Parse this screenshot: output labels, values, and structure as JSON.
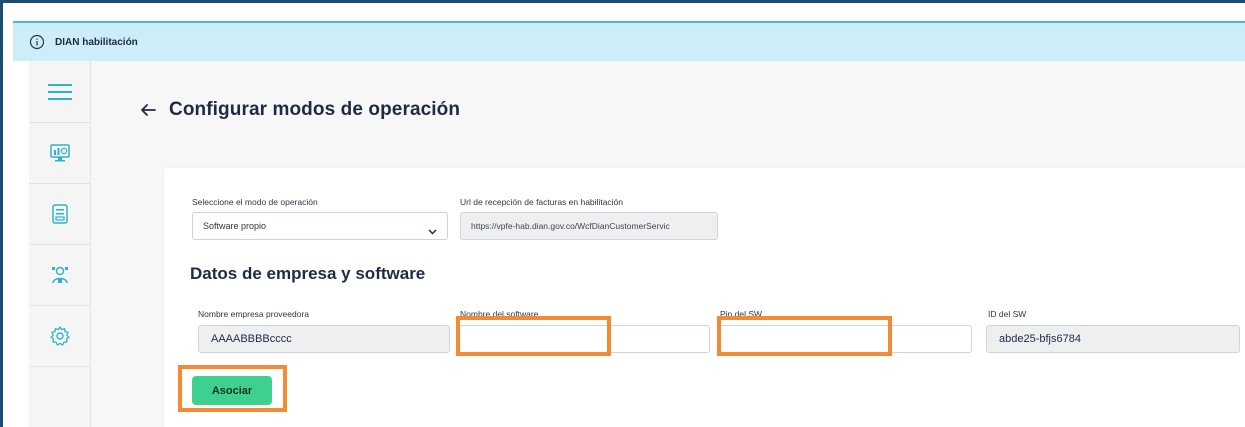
{
  "banner": {
    "title": "DIAN habilitación",
    "icon": "info-icon"
  },
  "sidebar": {
    "items": [
      {
        "icon": "hamburger-menu-icon"
      },
      {
        "icon": "monitor-dashboard-icon"
      },
      {
        "icon": "document-icon"
      },
      {
        "icon": "user-settings-icon"
      },
      {
        "icon": "gear-icon"
      }
    ]
  },
  "page": {
    "title": "Configurar modos de operación",
    "back_icon": "arrow-left-icon"
  },
  "form": {
    "mode_label": "Seleccione el modo de operación",
    "mode_value": "Software propio",
    "url_label": "Url de recepción de facturas en habilitación",
    "url_value": "https://vpfe-hab.dian.gov.co/WcfDianCustomerServic",
    "section_title": "Datos de empresa y software",
    "provider_label": "Nombre empresa proveedora",
    "provider_value": "AAAABBBBcccc",
    "software_name_label": "Nombre del software",
    "software_name_value": "",
    "pin_label": "Pin del SW",
    "pin_value": "",
    "sw_id_label": "ID del SW",
    "sw_id_value": "abde25-bfjs6784",
    "associate_label": "Asociar"
  },
  "colors": {
    "banner_bg": "#cdeef8",
    "accent_teal": "#2fb3c9",
    "primary_green": "#3ed08f",
    "highlight_orange": "#f58a34",
    "title_navy": "#1f2a44"
  }
}
